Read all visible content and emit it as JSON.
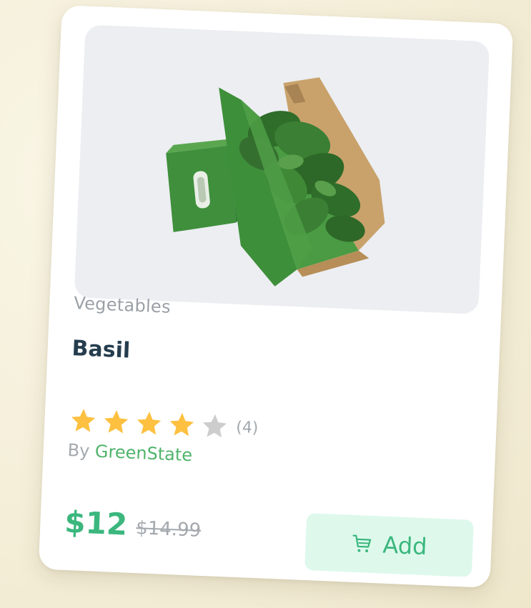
{
  "product": {
    "category": "Vegetables",
    "name": "Basil",
    "rating": 4,
    "rating_max": 5,
    "review_count": "(4)",
    "vendor_prefix": "By",
    "vendor_name": "GreenState",
    "price": "$12",
    "old_price": "$14.99",
    "image": "basil-box-photo"
  },
  "actions": {
    "add_label": "Add",
    "add_icon": "cart-icon"
  },
  "colors": {
    "accent": "#3bb77e",
    "star_filled": "#fdc040",
    "star_empty": "#cdcdcd",
    "button_bg": "#def9ec",
    "title": "#253d4e",
    "muted": "#a3a9ae"
  }
}
